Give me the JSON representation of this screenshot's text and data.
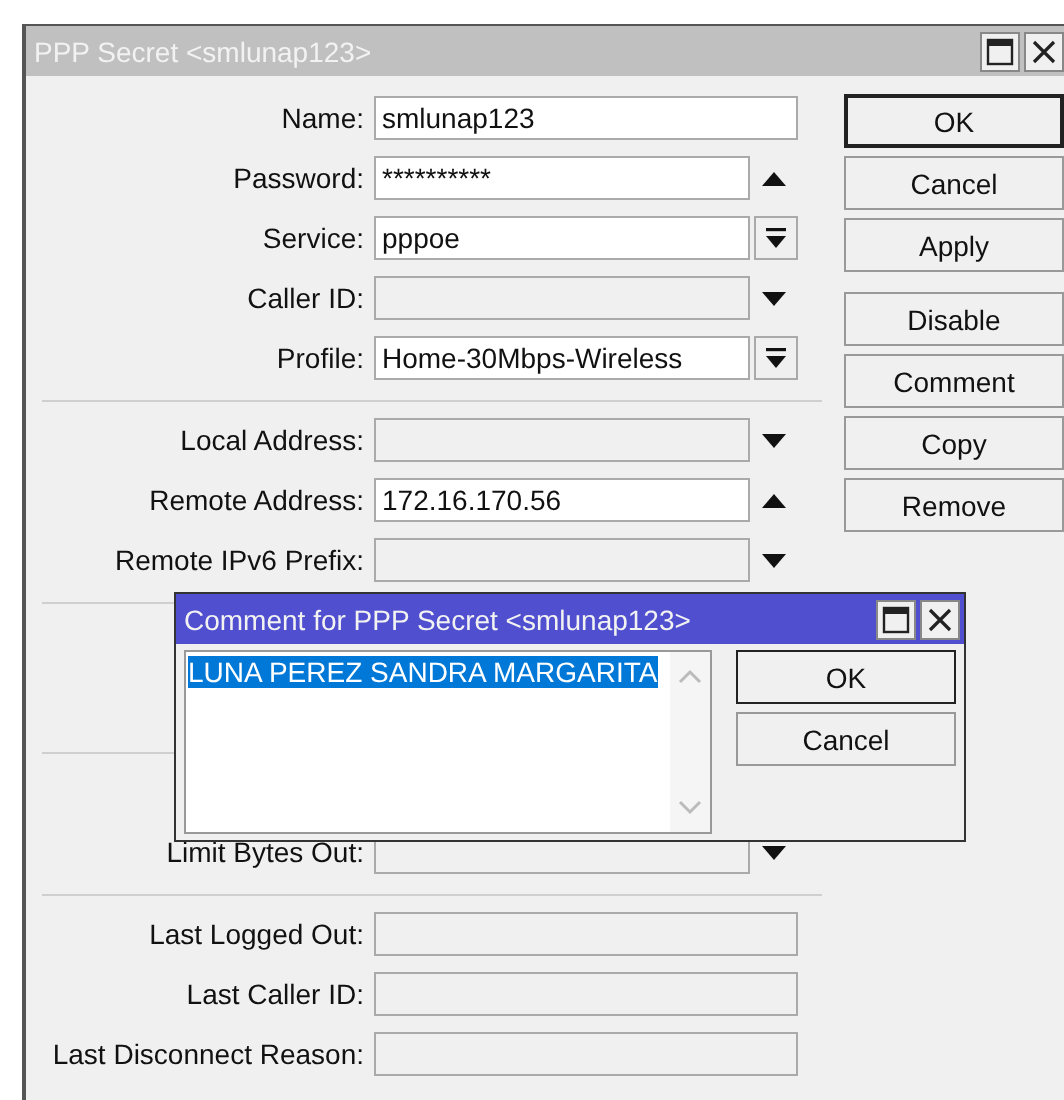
{
  "window": {
    "title": "PPP Secret <smlunap123>",
    "active": false
  },
  "sections": [
    {
      "rows": [
        {
          "label": "Name:",
          "kind": "text",
          "value": "smlunap123"
        },
        {
          "label": "Password:",
          "kind": "toggle",
          "value": "**********",
          "enabled": true
        },
        {
          "label": "Service:",
          "kind": "combo",
          "value": "pppoe"
        },
        {
          "label": "Caller ID:",
          "kind": "toggle",
          "enabled": false
        },
        {
          "label": "Profile:",
          "kind": "combo",
          "value": "Home-30Mbps-Wireless"
        }
      ]
    },
    {
      "rows": [
        {
          "label": "Local Address:",
          "kind": "toggle",
          "enabled": false
        },
        {
          "label": "Remote Address:",
          "kind": "toggle",
          "value": "172.16.170.56",
          "enabled": true
        },
        {
          "label": "Remote IPv6 Prefix:",
          "kind": "toggle",
          "enabled": false
        }
      ]
    },
    {
      "rows": [
        {
          "label": "Limit Bytes Out:",
          "kind": "toggle",
          "enabled": false
        }
      ]
    },
    {
      "rows": [
        {
          "label": "Last Logged Out:",
          "kind": "readonly"
        },
        {
          "label": "Last Caller ID:",
          "kind": "readonly"
        },
        {
          "label": "Last Disconnect Reason:",
          "kind": "readonly"
        }
      ]
    }
  ],
  "button_groups": [
    [
      {
        "label": "OK",
        "default": true
      },
      {
        "label": "Cancel",
        "default": false
      },
      {
        "label": "Apply",
        "default": false
      }
    ],
    [
      {
        "label": "Disable",
        "default": false
      },
      {
        "label": "Comment",
        "default": false
      },
      {
        "label": "Copy",
        "default": false
      },
      {
        "label": "Remove",
        "default": false
      }
    ]
  ],
  "dialog": {
    "title": "Comment for PPP Secret <smlunap123>",
    "active": true,
    "text": "LUNA PEREZ SANDRA MARGARITA",
    "text_selected": true,
    "buttons": [
      {
        "label": "OK",
        "default": true
      },
      {
        "label": "Cancel",
        "default": false
      }
    ]
  }
}
